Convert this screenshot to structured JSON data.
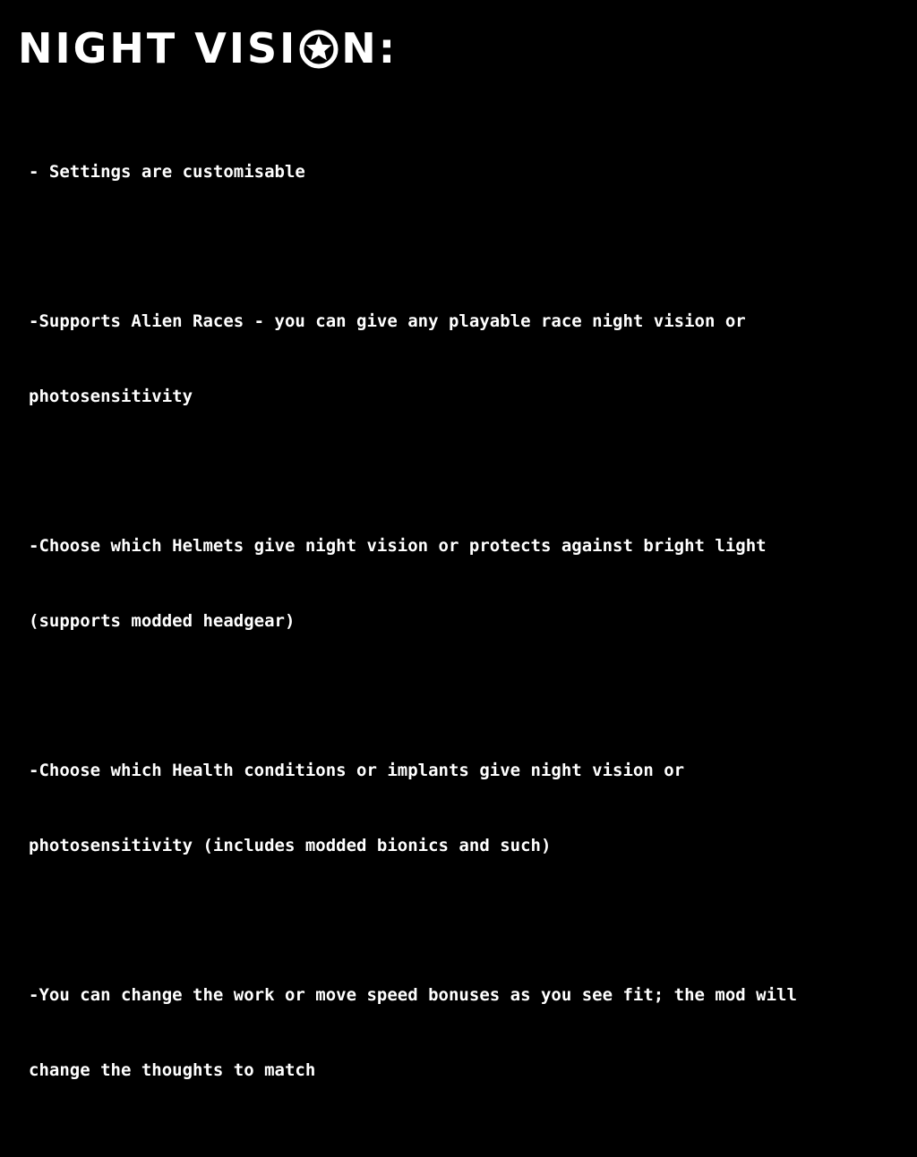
{
  "heading": {
    "before_o": "NIGHT VISI",
    "o_glyph": "O",
    "after_o": "N:",
    "o_icon": "star-in-circle-icon"
  },
  "features": [
    {
      "lines": [
        "- Settings are customisable"
      ]
    },
    {
      "lines": [
        "-Supports Alien Races - you can give any playable race night vision or",
        "photosensitivity"
      ]
    },
    {
      "lines": [
        "-Choose which Helmets give night vision or protects against bright light",
        "(supports modded headgear)"
      ]
    },
    {
      "lines": [
        "-Choose which Health conditions or implants give night vision or",
        "photosensitivity (includes modded bionics and such)"
      ]
    },
    {
      "lines": [
        "-You can change the work or move speed bonuses as you see fit; the mod will",
        "change the thoughts to match"
      ]
    }
  ],
  "colors": {
    "background": "#000000",
    "text": "#ffffff"
  }
}
